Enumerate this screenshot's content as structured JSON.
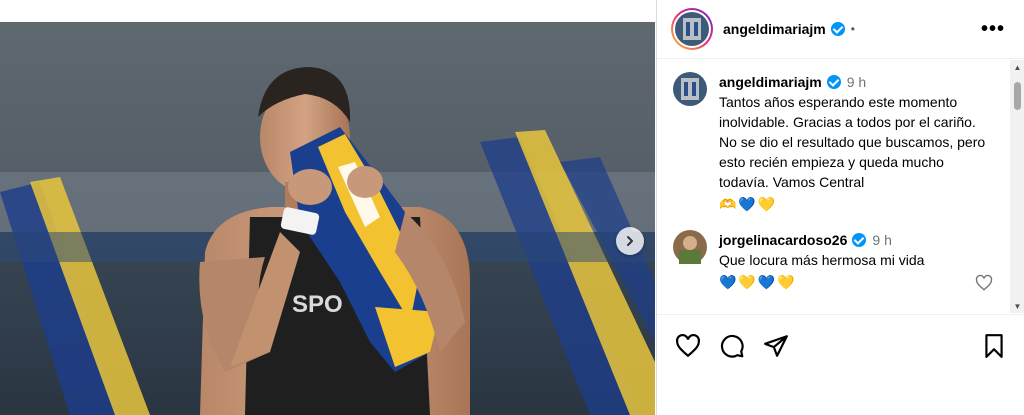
{
  "post": {
    "username": "angeldimariajm",
    "verified": true,
    "more_label": "•••"
  },
  "caption": {
    "username": "angeldimariajm",
    "time": "9 h",
    "text": "Tantos años esperando este momento inolvidable. Gracias a todos por el cariño. No se dio el resultado que buscamos, pero esto recién empieza y queda mucho todavía. Vamos Central",
    "emojis": "🫶💙💛"
  },
  "comments": [
    {
      "username": "jorgelinacardoso26",
      "time": "9 h",
      "text": "Que locura más hermosa mi vida",
      "emojis": "💙💛💙💛"
    }
  ],
  "icons": {
    "like": "heart-icon",
    "comment": "comment-icon",
    "share": "share-icon",
    "save": "bookmark-icon",
    "next": "chevron-right-icon",
    "more": "more-icon"
  },
  "colors": {
    "verified": "#0095f6",
    "jersey_blue": "#1b3f8f",
    "jersey_yellow": "#f2c230"
  }
}
